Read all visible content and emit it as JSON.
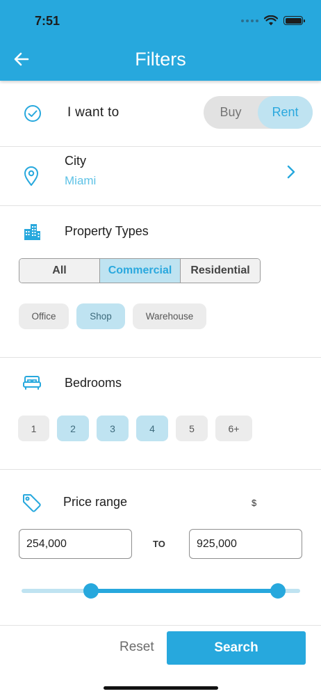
{
  "status_bar": {
    "time": "7:51"
  },
  "header": {
    "title": "Filters"
  },
  "intent": {
    "label": "I want to",
    "options": [
      "Buy",
      "Rent"
    ],
    "selected": "Rent"
  },
  "city": {
    "label": "City",
    "value": "Miami"
  },
  "property_types": {
    "label": "Property Types",
    "categories": [
      "All",
      "Commercial",
      "Residential"
    ],
    "selected_category": "Commercial",
    "subtypes": [
      "Office",
      "Shop",
      "Warehouse"
    ],
    "selected_subtypes": [
      "Shop"
    ]
  },
  "bedrooms": {
    "label": "Bedrooms",
    "options": [
      "1",
      "2",
      "3",
      "4",
      "5",
      "6+"
    ],
    "selected": [
      "2",
      "3",
      "4"
    ]
  },
  "price": {
    "label": "Price range",
    "currency": "$",
    "min_value": "254,000",
    "max_value": "925,000",
    "to_label": "TO",
    "slider_low_fraction": 0.25,
    "slider_high_fraction": 0.92
  },
  "footer": {
    "reset_label": "Reset",
    "search_label": "Search"
  },
  "colors": {
    "accent": "#27a8dd",
    "accent_light": "#bfe3f1",
    "selected_text": "#2aa8de"
  },
  "icons": {
    "back": "arrow-left-icon",
    "want": "check-circle-icon",
    "city": "location-pin-icon",
    "city_chevron": "chevron-right-icon",
    "property": "buildings-icon",
    "bedrooms": "bed-icon",
    "price": "price-tag-icon"
  }
}
